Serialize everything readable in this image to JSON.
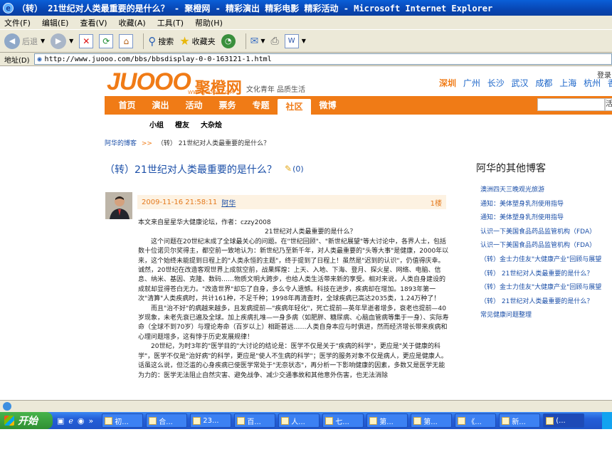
{
  "window": {
    "title": "（转） 21世纪对人类最重要的是什么？ - 聚橙网 - 精彩演出 精彩电影 精彩活动 - Microsoft Internet Explorer"
  },
  "menu": [
    "文件(F)",
    "编辑(E)",
    "查看(V)",
    "收藏(A)",
    "工具(T)",
    "帮助(H)"
  ],
  "toolbar": {
    "back": "后退",
    "search": "搜索",
    "favorites": "收藏夹"
  },
  "address": {
    "label": "地址(D)",
    "url": "http://www.juooo.com/bbs/bbsdisplay-0-0-163121-1.html"
  },
  "site": {
    "logo_text": "JUOOO",
    "logo_cn": "聚橙网",
    "logo_url": "WWW.JUOOO.COM",
    "slogan": "文化青年 品质生活",
    "login": "登录",
    "cities_current": "深圳",
    "cities": [
      "广州",
      "长沙",
      "武汉",
      "成都",
      "上海",
      "杭州",
      "香港"
    ],
    "nav": [
      "首页",
      "演出",
      "活动",
      "票务",
      "专题",
      "社区",
      "微博"
    ],
    "search_btn": "活",
    "subnav": [
      "小组",
      "橙友",
      "大杂烩"
    ]
  },
  "breadcrumb": {
    "blog": "阿华的博客",
    "sep": ">>",
    "current": "（转） 21世纪对人类最重要的是什么？"
  },
  "post": {
    "title": "（转）21世纪对人类最重要的是什么？",
    "comments": "(0)",
    "datetime": "2009-11-16 21:58:11",
    "author": "阿华",
    "floor": "1楼",
    "source": "本文来自星星华大健康论坛，作者：czzy2008",
    "heading": "21世纪对人类最重要的是什么？",
    "p1": "这个问题在20世纪末成了全球最关心的问题。在\"世纪回顾\"、\"新世纪展望\"等大讨论中，各界人士，包括数十位诺贝尔奖得主，都空前一致地认为：新世纪乃至新千年，对人类最重要的\"头等大事\"是健康，2000年以来，这个始终未能提到日程上的\"人类永恒的主题\"，终于提到了日程上！虽然是\"迟到的认识\"，仍值得庆幸。诚然，20世纪在改造客观世界上成就空前，战果辉煌：上天、入地、下海、登月、探火星、网络、电脑、信息、纳米、基因、克隆、数码……物质文明大跨步，也给人类生活带来新的享受。相对来说，人类自身建设的成就却显得苍白无力。\"改造世界\"却忘了自身，多么令人遗憾。科技在进步，疾病却在增加。1893年第一次\"清算\"人类疾病时，共计161种，不足千种；1998年再清查时，全球疾病已高达2035类，1.24万种了！",
    "p2": "而且\"治不好\"的病越来越多，且发病提前—\"疾病年轻化\"，死亡提前—英年早逝者增多，衰老也提前—40岁现象，未老先衰已遍及全球。加上疾病扎堆—一身多病（如肥胖、糖尿病、心脑血管病等集于一身）、实际寿命（全球不到70岁）与理论寿命（百岁以上）相距甚远……人类自身本应与时俱进，然而经济增长带来疾病和心理问题增多，这有悖于历史发展规律！",
    "p3": "20世纪，为时3年的\"医学目的\"大讨论的结论是：医学不仅是关于\"疾病的科学\"，更应是\"关于健康的科学\"，医学不仅是\"治好病\"的科学，更应是\"使人不生病的科学\"；医学的服务对象不仅是病人，更应是健康人。话虽这么说，但泛滥的心身疾病已使医学常处于\"无奈状态\"，再分析一下影响健康的因素，多数又是医学无能为力的：医学无法阻止自然灾害、避免战争、减少交通事故和其他意外伤害，也无法消除"
  },
  "sidebar": {
    "title": "阿华的其他博客",
    "items": [
      "澳洲四天三晚观光旅游",
      "通知：美体塑身乳剂使用指导",
      "通知：美体塑身乳剂使用指导",
      "认识一下美国食品药品监管机构（FDA）",
      "认识一下美国食品药品监管机构（FDA）",
      "（转）金士力佳友\"大健康产业\"回顾与展望",
      "（转） 21世纪对人类最重要的是什么？",
      "（转）金士力佳友\"大健康产业\"回顾与展望",
      "（转） 21世纪对人类最重要的是什么？",
      "常见健康问题整理"
    ]
  },
  "taskbar": {
    "start": "开始",
    "tasks": [
      "初...",
      "合...",
      "23...",
      "百...",
      "人...",
      "七...",
      "第...",
      "第...",
      "《...",
      "新...",
      "(..."
    ]
  }
}
